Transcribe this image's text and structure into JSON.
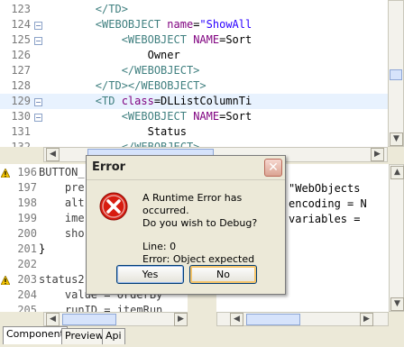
{
  "top_editor": {
    "lines": [
      {
        "n": "123",
        "parts": [
          {
            "t": "        ",
            "c": "txt"
          },
          {
            "t": "</TD>",
            "c": "tag"
          }
        ]
      },
      {
        "n": "124",
        "fold": "−",
        "parts": [
          {
            "t": "        ",
            "c": "txt"
          },
          {
            "t": "<WEBOBJECT ",
            "c": "tag"
          },
          {
            "t": "name",
            "c": "attr"
          },
          {
            "t": "=",
            "c": "txt"
          },
          {
            "t": "\"ShowAll",
            "c": "str"
          }
        ]
      },
      {
        "n": "125",
        "fold": "−",
        "parts": [
          {
            "t": "            ",
            "c": "txt"
          },
          {
            "t": "<WEBOBJECT ",
            "c": "tag"
          },
          {
            "t": "NAME",
            "c": "attr"
          },
          {
            "t": "=Sort",
            "c": "txt"
          }
        ]
      },
      {
        "n": "126",
        "parts": [
          {
            "t": "                Owner",
            "c": "txt"
          }
        ]
      },
      {
        "n": "127",
        "parts": [
          {
            "t": "            ",
            "c": "txt"
          },
          {
            "t": "</WEBOBJECT>",
            "c": "tag"
          }
        ]
      },
      {
        "n": "128",
        "parts": [
          {
            "t": "        ",
            "c": "txt"
          },
          {
            "t": "</TD></WEBOBJECT>",
            "c": "tag"
          }
        ]
      },
      {
        "n": "129",
        "fold": "−",
        "hl": true,
        "parts": [
          {
            "t": "        ",
            "c": "txt"
          },
          {
            "t": "<TD ",
            "c": "tag"
          },
          {
            "t": "class",
            "c": "attr"
          },
          {
            "t": "=DLListColumnTi",
            "c": "txt"
          }
        ]
      },
      {
        "n": "130",
        "fold": "−",
        "parts": [
          {
            "t": "            ",
            "c": "txt"
          },
          {
            "t": "<WEBOBJECT ",
            "c": "tag"
          },
          {
            "t": "NAME",
            "c": "attr"
          },
          {
            "t": "=Sort",
            "c": "txt"
          }
        ]
      },
      {
        "n": "131",
        "parts": [
          {
            "t": "                Status",
            "c": "txt"
          }
        ]
      },
      {
        "n": "132",
        "parts": [
          {
            "t": "            ",
            "c": "txt"
          },
          {
            "t": "</WEBOBJECT>",
            "c": "tag"
          }
        ]
      }
    ]
  },
  "bottom_left_editor": {
    "lines": [
      {
        "n": "196",
        "warn": true,
        "parts": [
          {
            "t": "BUTTON_",
            "c": "kw"
          }
        ]
      },
      {
        "n": "197",
        "parts": [
          {
            "t": "    pre",
            "c": "kw"
          }
        ]
      },
      {
        "n": "198",
        "parts": [
          {
            "t": "    alt",
            "c": "kw"
          }
        ]
      },
      {
        "n": "199",
        "parts": [
          {
            "t": "    ime",
            "c": "kw"
          }
        ]
      },
      {
        "n": "200",
        "parts": [
          {
            "t": "    sho",
            "c": "kw"
          }
        ]
      },
      {
        "n": "201",
        "parts": [
          {
            "t": "}",
            "c": "txt"
          }
        ]
      },
      {
        "n": "202",
        "parts": [
          {
            "t": "",
            "c": "txt"
          }
        ]
      },
      {
        "n": "203",
        "warn": true,
        "parts": [
          {
            "t": "status2",
            "c": "kw"
          }
        ]
      },
      {
        "n": "204",
        "parts": [
          {
            "t": "    value = orderBy",
            "c": "kw"
          }
        ]
      },
      {
        "n": "205",
        "parts": [
          {
            "t": "    runID = itemRun",
            "c": "kw"
          }
        ]
      }
    ]
  },
  "bottom_right_editor": {
    "lines": [
      {
        "parts": [
          {
            "t": "\"WebObjects",
            "c": "txt"
          }
        ]
      },
      {
        "parts": [
          {
            "t": "encoding = N",
            "c": "txt"
          }
        ]
      },
      {
        "parts": [
          {
            "t": "variables =",
            "c": "txt"
          }
        ]
      }
    ]
  },
  "dialog": {
    "title": "Error",
    "message_line1": "A Runtime Error has occurred.",
    "message_line2": "Do you wish to Debug?",
    "detail_line1": "Line: 0",
    "detail_line2": "Error: Object expected",
    "yes_label": "Yes",
    "no_label": "No",
    "close_glyph": "✕",
    "icon": "error-icon"
  },
  "tabs": [
    {
      "label": "Component",
      "active": true
    },
    {
      "label": "Preview",
      "active": false
    },
    {
      "label": "Api",
      "active": false
    }
  ],
  "glyphs": {
    "left": "◀",
    "right": "▶",
    "up": "▲",
    "down": "▼"
  }
}
